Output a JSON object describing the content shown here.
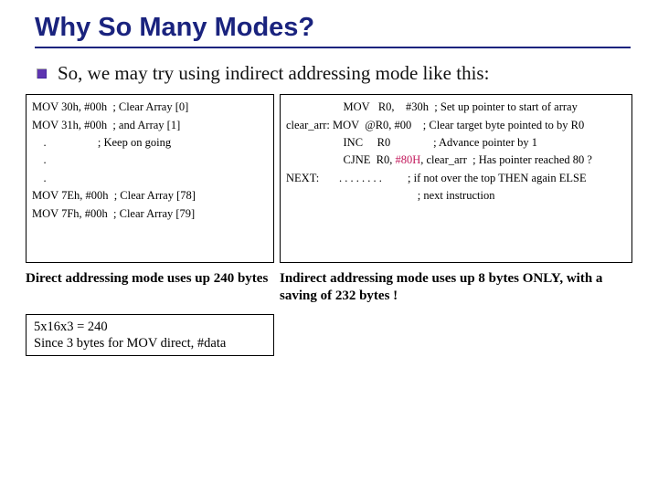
{
  "title": "Why So Many Modes?",
  "intro": "So, we may try using indirect addressing mode like this:",
  "left_code": {
    "l1": "MOV 30h, #00h  ; Clear Array [0]",
    "l2": "MOV 31h, #00h  ; and Array [1]",
    "l3": "    .                  ; Keep on going",
    "l4": "    .",
    "l5": "    .",
    "l6": "MOV 7Eh, #00h  ; Clear Array [78]",
    "l7": "MOV 7Fh, #00h  ; Clear Array [79]"
  },
  "right_code": {
    "r1a": "                    MOV   R0,    #30h  ; Set up pointer to start of array",
    "r2a": "clear_arr: MOV  @R0, #00    ; Clear target byte pointed to by R0",
    "r3a": "                    INC     R0               ; Advance pointer by 1",
    "r4a": "                    CJNE  R0, ",
    "r4b": "#80H",
    "r4c": ", clear_arr  ; Has pointer reached 80 ?",
    "r5a": "NEXT:       . . . . . . . .         ; if not over the top THEN again ELSE",
    "r6a": "                                              ; next instruction"
  },
  "caption_left": "Direct addressing mode uses up 240 bytes",
  "caption_right": "Indirect addressing mode uses up 8 bytes ONLY, with a saving of 232 bytes !",
  "note": {
    "n1": "5x16x3 = 240",
    "n2": "Since 3 bytes for  MOV direct, #data"
  }
}
